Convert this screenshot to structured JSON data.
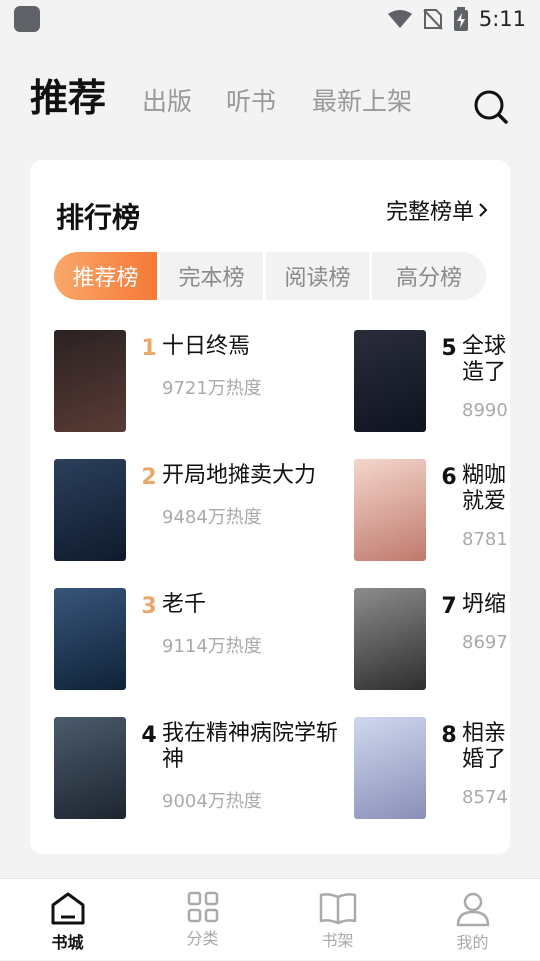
{
  "status_bar": {
    "time": "5:11"
  },
  "header": {
    "tabs": [
      "推荐",
      "出版",
      "听书",
      "最新上架"
    ],
    "active_tab": "推荐"
  },
  "ranking": {
    "title": "排行榜",
    "full_list": "完整榜单",
    "segments": [
      "推荐榜",
      "完本榜",
      "阅读榜",
      "高分榜"
    ],
    "active_segment": "推荐榜",
    "items": [
      {
        "rank": "1",
        "title": "十日终焉",
        "heat": "9721万热度",
        "cover_colors": [
          "#2a2222",
          "#5a3b35"
        ]
      },
      {
        "rank": "2",
        "title": "开局地摊卖大力",
        "heat": "9484万热度",
        "cover_colors": [
          "#2b3f5c",
          "#0f1a2c"
        ]
      },
      {
        "rank": "3",
        "title": "老千",
        "heat": "9114万热度",
        "cover_colors": [
          "#37557a",
          "#0f2238"
        ]
      },
      {
        "rank": "4",
        "title": "我在精神病院学斩神",
        "heat": "9004万热度",
        "cover_colors": [
          "#4b5b6c",
          "#1d2530"
        ]
      },
      {
        "rank": "5",
        "title": "全球造了",
        "heat": "8990",
        "cover_colors": [
          "#2a2d3a",
          "#0f1320"
        ]
      },
      {
        "rank": "6",
        "title": "糊咖就爱",
        "heat": "8781",
        "cover_colors": [
          "#f4d6cc",
          "#c0796c"
        ]
      },
      {
        "rank": "7",
        "title": "坍缩",
        "heat": "8697",
        "cover_colors": [
          "#8c8c8c",
          "#2e2e2e"
        ]
      },
      {
        "rank": "8",
        "title": "相亲婚了",
        "heat": "8574",
        "cover_colors": [
          "#cfd8ef",
          "#8a8fb8"
        ]
      }
    ]
  },
  "bottom_nav": {
    "items": [
      "书城",
      "分类",
      "书架",
      "我的"
    ],
    "active": "书城"
  },
  "colors": {
    "accent_start": "#f9a86a",
    "accent_end": "#f67937",
    "rank_top": "#e9a86a"
  }
}
